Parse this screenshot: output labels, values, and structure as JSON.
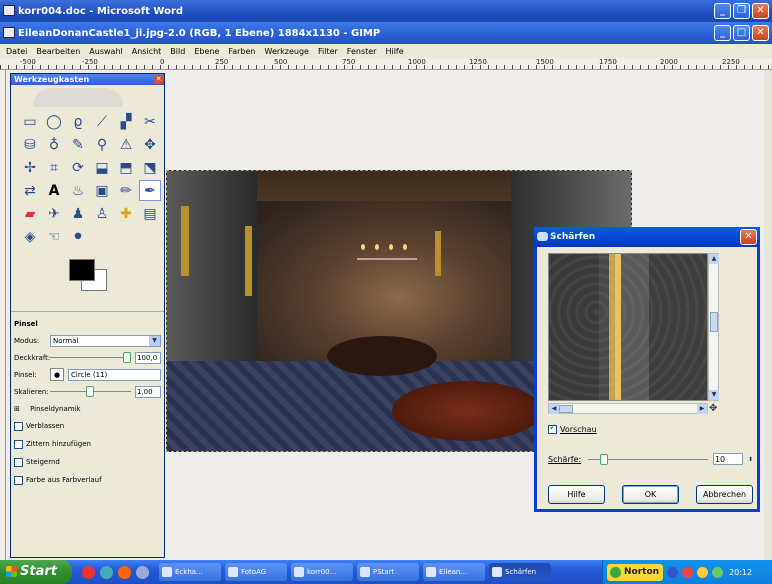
{
  "word_window": {
    "title": "korr004.doc - Microsoft Word"
  },
  "gimp_window": {
    "title": "EileanDonanCastle1_ji.jpg-2.0 (RGB, 1 Ebene) 1884x1130 - GIMP",
    "menu": [
      "Datei",
      "Bearbeiten",
      "Auswahl",
      "Ansicht",
      "Bild",
      "Ebene",
      "Farben",
      "Werkzeuge",
      "Filter",
      "Fenster",
      "Hilfe"
    ],
    "ruler_labels": [
      "-500",
      "-250",
      "0",
      "250",
      "500",
      "750",
      "1000",
      "1250",
      "1500",
      "1750",
      "2000",
      "2250"
    ]
  },
  "toolbox": {
    "title": "Werkzeugkasten",
    "brush_panel": {
      "header": "Pinsel",
      "mode_label": "Modus:",
      "mode_value": "Normal",
      "opacity_label": "Deckkraft:",
      "opacity_value": "100,0",
      "opacity_level": 1.0,
      "brush_label": "Pinsel:",
      "brush_value": "Circle (11)",
      "scale_label": "Skalieren:",
      "scale_value": "1,00",
      "dynamics_label": "Pinseldynamik",
      "options": [
        "Verblassen",
        "Zittern hinzufügen",
        "Steigernd",
        "Farbe aus Farbverlauf"
      ]
    }
  },
  "sharpen_dialog": {
    "title": "Schärfen",
    "preview_label": "Vorschau",
    "preview_checked": true,
    "sharpness_label": "Schärfe:",
    "sharpness_value": "10",
    "sharpness_level": 0.1,
    "buttons": {
      "help": "Hilfe",
      "ok": "OK",
      "cancel": "Abbrechen"
    }
  },
  "taskbar": {
    "start_label": "Start",
    "tasks": [
      {
        "label": "Eckha...",
        "active": false
      },
      {
        "label": "FotoAG",
        "active": false
      },
      {
        "label": "korr00...",
        "active": false
      },
      {
        "label": "PStart",
        "active": false
      },
      {
        "label": "Eilean...",
        "active": false
      },
      {
        "label": "Schärfen",
        "active": true
      }
    ],
    "norton_label": "Norton",
    "clock": "20:12"
  }
}
